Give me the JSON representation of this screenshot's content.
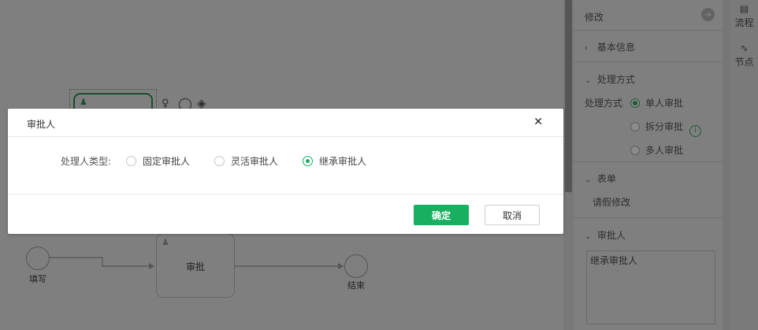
{
  "diagram": {
    "start_label": "填写",
    "task_label": "审批",
    "end_label": "结束"
  },
  "panel": {
    "edit_label": "修改",
    "basic_info_label": "基本信息",
    "handling_section_label": "处理方式",
    "handling_field_label": "处理方式",
    "handling_options": [
      "单人审批",
      "拆分审批",
      "多人审批"
    ],
    "handling_selected": "单人审批",
    "form_section_label": "表单",
    "form_value": "请假修改",
    "approver_section_label": "审批人",
    "approver_value": "继承审批人"
  },
  "side_tabs": {
    "process_label": "流程",
    "node_label": "节点"
  },
  "modal": {
    "title": "审批人",
    "field_label": "处理人类型:",
    "options": [
      "固定审批人",
      "灵活审批人",
      "继承审批人"
    ],
    "selected": "继承审批人",
    "ok_label": "确定",
    "cancel_label": "取消"
  },
  "colors": {
    "accent": "#18b060",
    "overlay": "#7f7f7f"
  }
}
